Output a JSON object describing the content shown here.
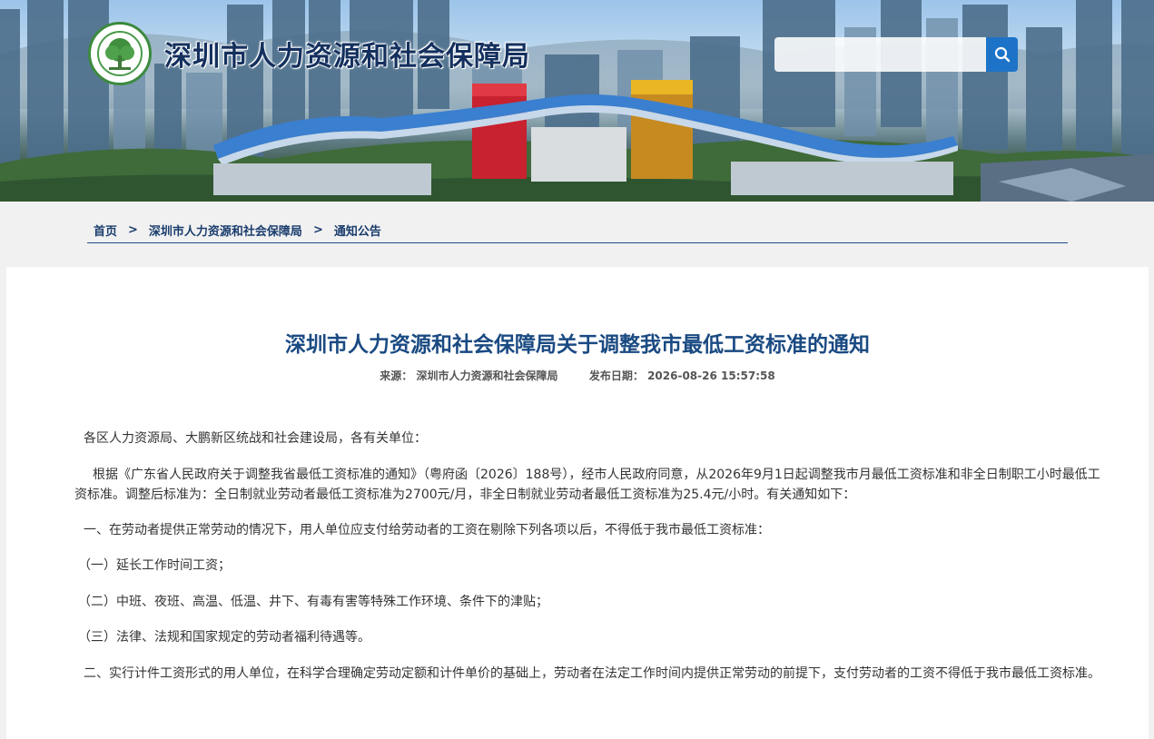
{
  "header": {
    "site_title": "深圳市人力资源和社会保障局",
    "search_placeholder": "",
    "search_icon": "search-icon",
    "logo_icon": "tree-emblem-icon"
  },
  "breadcrumb": {
    "items": [
      "首页",
      "深圳市人力资源和社会保障局",
      "通知公告"
    ],
    "separator": ">"
  },
  "article": {
    "title": "深圳市人力资源和社会保障局关于调整我市最低工资标准的通知",
    "source_label": "来源：",
    "source_value": "深圳市人力资源和社会保障局",
    "date_label": "发布日期：",
    "date_value": "2026-08-26 15:57:58",
    "paragraphs": [
      "各区人力资源局、大鹏新区统战和社会建设局，各有关单位：",
      "根据《广东省人民政府关于调整我省最低工资标准的通知》（粤府函〔2026〕188号），经市人民政府同意，从2026年9月1日起调整我市月最低工资标准和非全日制职工小时最低工资标准。调整后标准为：全日制就业劳动者最低工资标准为2700元/月，非全日制就业劳动者最低工资标准为25.4元/小时。有关通知如下：",
      "一、在劳动者提供正常劳动的情况下，用人单位应支付给劳动者的工资在剔除下列各项以后，不得低于我市最低工资标准：",
      "（一）延长工作时间工资；",
      "（二）中班、夜班、高温、低温、井下、有毒有害等特殊工作环境、条件下的津贴；",
      "（三）法律、法规和国家规定的劳动者福利待遇等。",
      "二、实行计件工资形式的用人单位，在科学合理确定劳动定额和计件单价的基础上，劳动者在法定工作时间内提供正常劳动的前提下，支付劳动者的工资不得低于我市最低工资标准。"
    ]
  },
  "colors": {
    "title_blue": "#1a4a82",
    "search_button": "#1d73c8",
    "crumb_line": "#1b4f87"
  }
}
